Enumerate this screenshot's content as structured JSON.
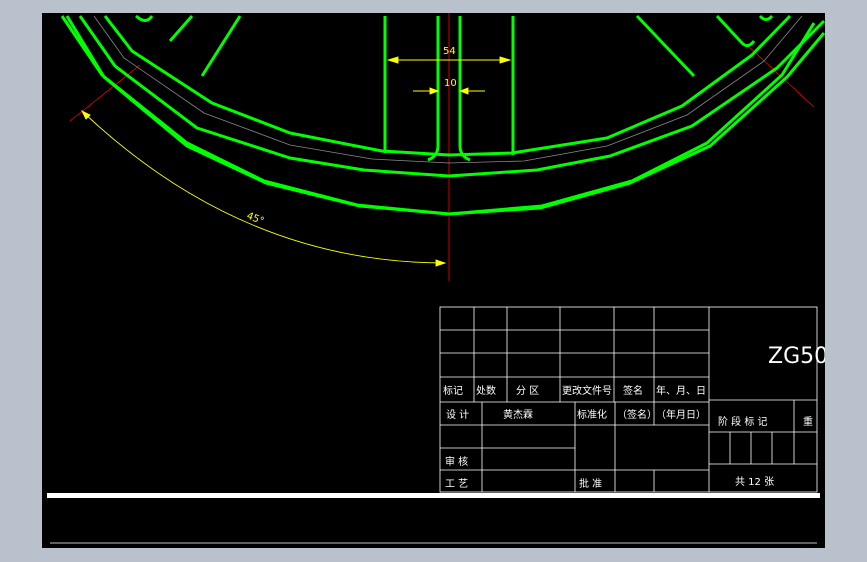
{
  "drawing": {
    "dimensions": {
      "width_label": "54",
      "slot_label": "10",
      "angle_label": "45°"
    },
    "colors": {
      "background": "#000000",
      "outline": "#00ff00",
      "dimension": "#ffff00",
      "centerline": "#ff0000",
      "title_block": "#ffffff",
      "frame": "#b9c2cc"
    }
  },
  "title_block": {
    "drawing_code": "ZG50",
    "header_row": {
      "mark": "标记",
      "count": "处数",
      "zone": "分  区",
      "change_doc": "更改文件号",
      "signature": "签名",
      "date": "年、月、日"
    },
    "design_label": "设  计",
    "designer_name": "黄杰霖",
    "standardize_label": "标准化",
    "sign_placeholder": "（签名）",
    "date_placeholder": "（年月日）",
    "stage_mark_label": "阶  段  标  记",
    "weight_label": "重",
    "review_label": "审  核",
    "process_label": "工  艺",
    "approve_label": "批  准",
    "sheets_label": "共 12  张"
  }
}
